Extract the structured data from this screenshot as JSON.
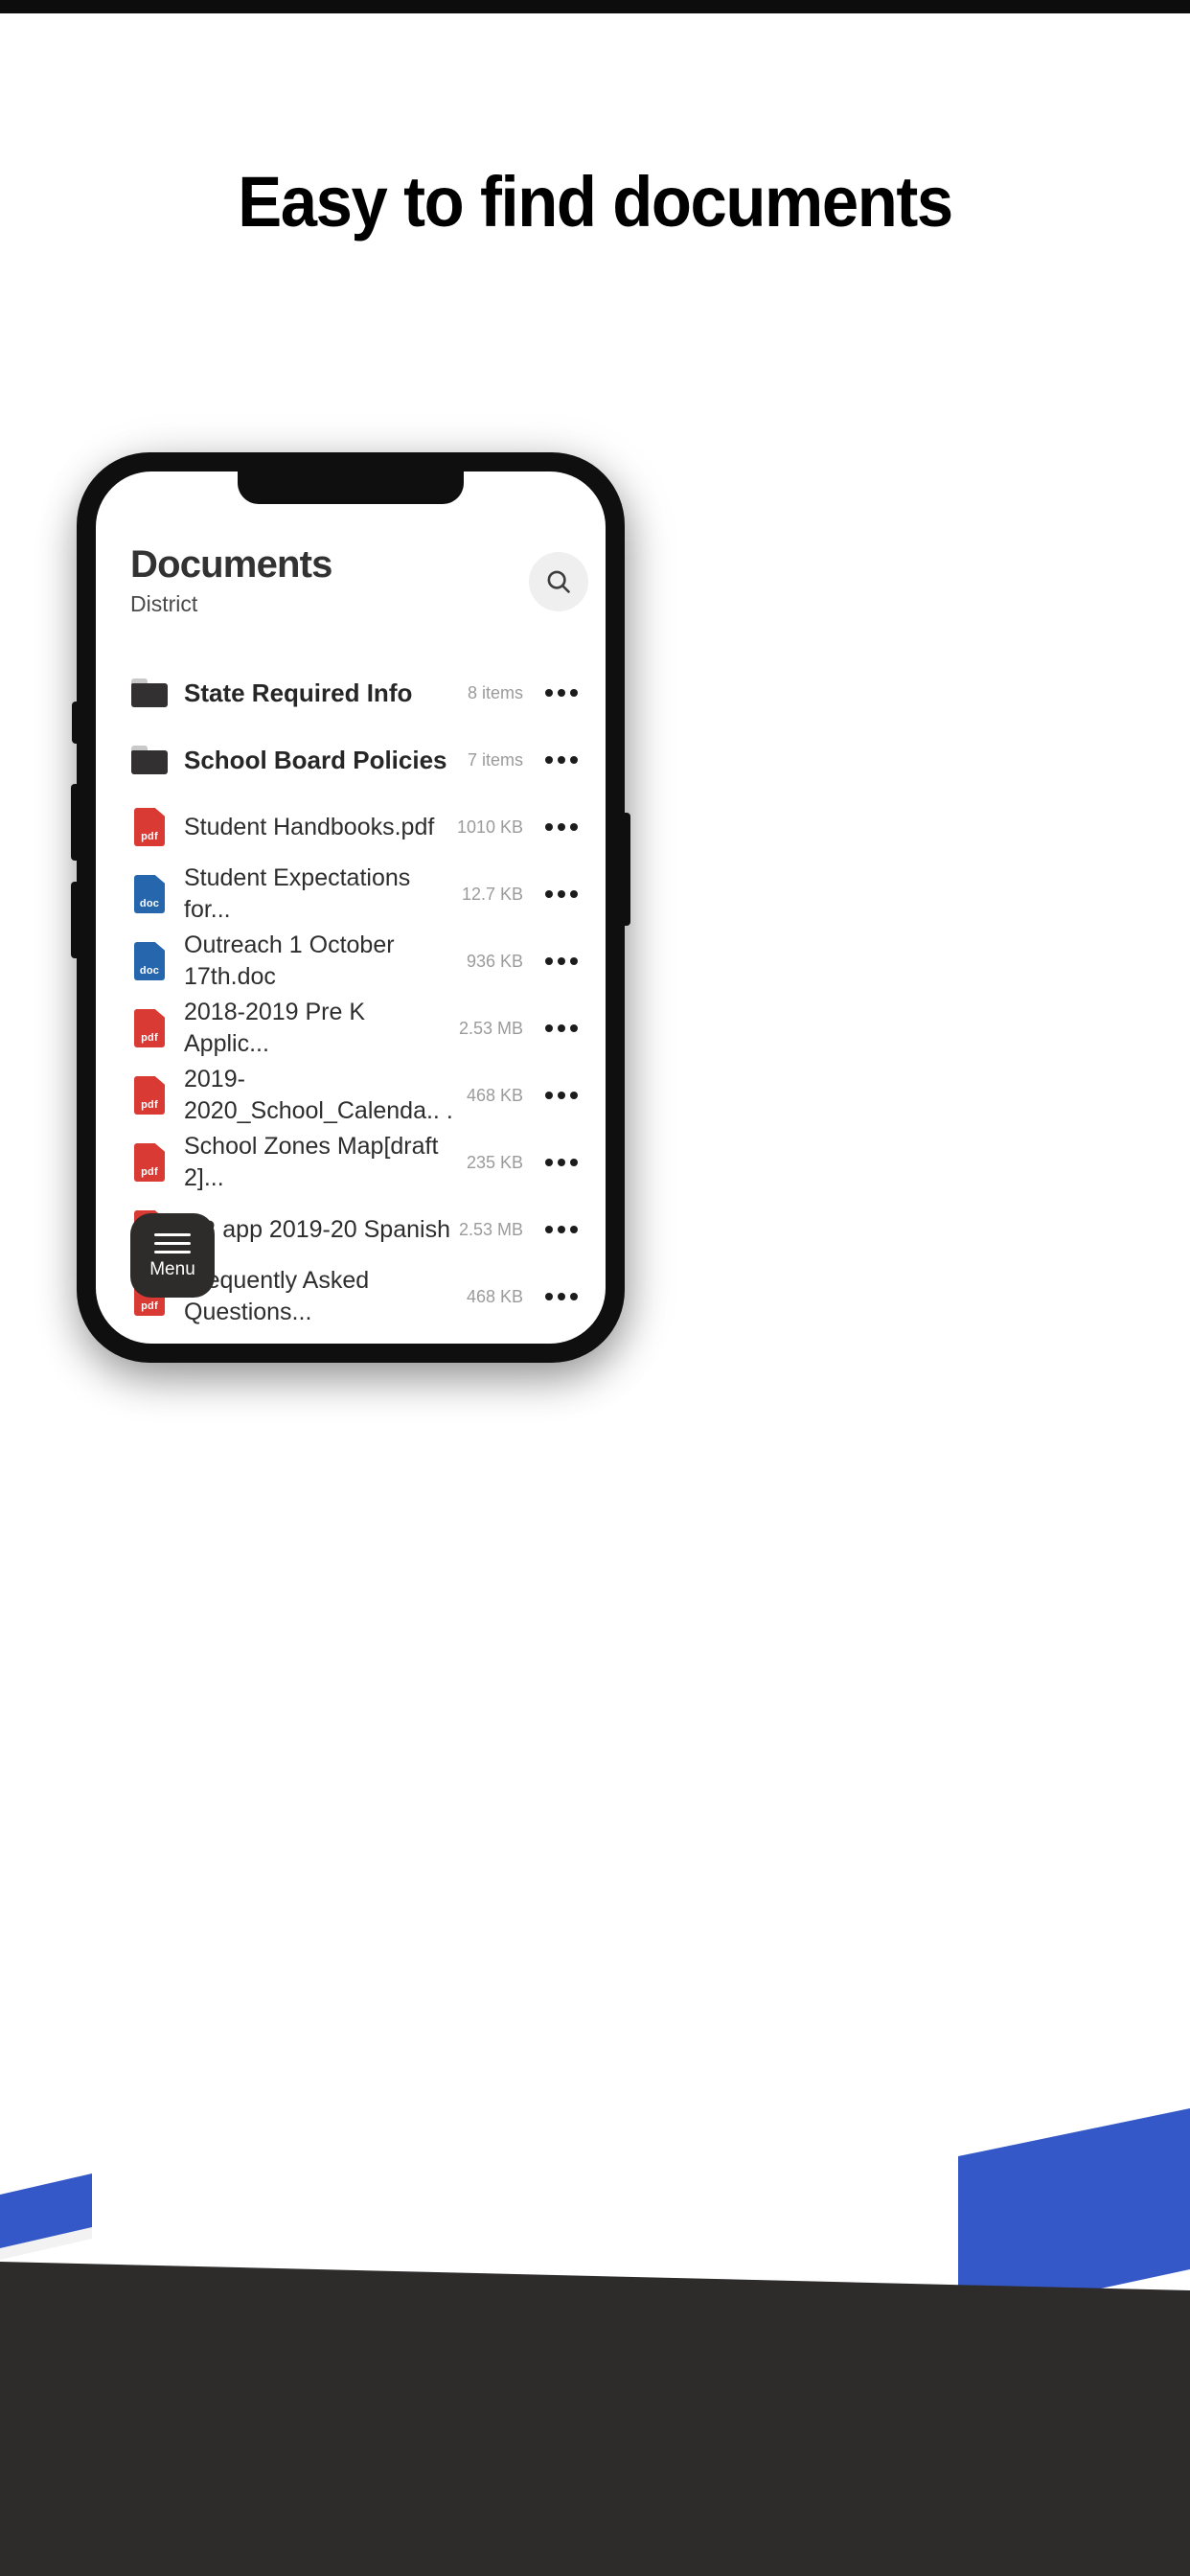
{
  "headline": "Easy to find documents",
  "colors": {
    "blue_band": "#3458c8",
    "dark_footer": "#2e2b2b",
    "pdf_red": "#d93a33",
    "doc_blue": "#2566ad",
    "folder_dark": "#333031",
    "fab_dark": "#2e2b2b"
  },
  "app": {
    "title": "Documents",
    "subtitle": "District",
    "search_icon": "search-icon",
    "overflow_icon": "ellipsis-icon",
    "menu": {
      "label": "Menu",
      "icon": "hamburger-icon"
    },
    "items": [
      {
        "kind": "folder",
        "icon": "folder-icon",
        "name": "State Required Info",
        "meta": "8 items"
      },
      {
        "kind": "folder",
        "icon": "folder-icon",
        "name": "School Board Policies",
        "meta": "7 items"
      },
      {
        "kind": "file",
        "ext": "pdf",
        "icon": "pdf-file-icon",
        "name": "Student Handbooks.pdf",
        "meta": "1010 KB"
      },
      {
        "kind": "file",
        "ext": "doc",
        "icon": "doc-file-icon",
        "name": "Student Expectations for...",
        "meta": "12.7 KB"
      },
      {
        "kind": "file",
        "ext": "doc",
        "icon": "doc-file-icon",
        "name": "Outreach 1 October 17th.doc",
        "meta": "936 KB"
      },
      {
        "kind": "file",
        "ext": "pdf",
        "icon": "pdf-file-icon",
        "name": "2018-2019 Pre K Applic...",
        "meta": "2.53 MB"
      },
      {
        "kind": "file",
        "ext": "pdf",
        "icon": "pdf-file-icon",
        "name": "2019-2020_School_Calenda..\n.",
        "meta": "468 KB"
      },
      {
        "kind": "file",
        "ext": "pdf",
        "icon": "pdf-file-icon",
        "name": "School Zones Map[draft 2]...",
        "meta": "235 KB"
      },
      {
        "kind": "file",
        "ext": "pdf",
        "icon": "pdf-file-icon",
        "name": "FR app 2019-20 Spanish",
        "meta": "2.53 MB"
      },
      {
        "kind": "file",
        "ext": "pdf",
        "icon": "pdf-file-icon",
        "name": "Frequently Asked Questions...",
        "meta": "468 KB"
      }
    ]
  }
}
